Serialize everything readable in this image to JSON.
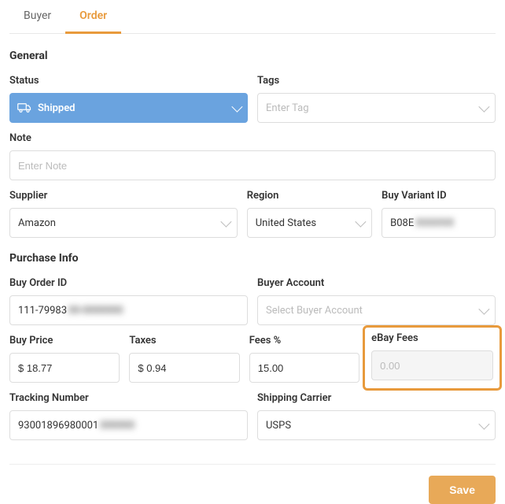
{
  "tabs": {
    "buyer": "Buyer",
    "order": "Order"
  },
  "sections": {
    "general": "General",
    "purchase": "Purchase Info"
  },
  "labels": {
    "status": "Status",
    "tags": "Tags",
    "note": "Note",
    "supplier": "Supplier",
    "region": "Region",
    "buy_variant_id": "Buy Variant ID",
    "buy_order_id": "Buy Order ID",
    "buyer_account": "Buyer Account",
    "buy_price": "Buy Price",
    "taxes": "Taxes",
    "fees_pct": "Fees %",
    "ebay_fees": "eBay Fees",
    "tracking_number": "Tracking Number",
    "shipping_carrier": "Shipping Carrier"
  },
  "values": {
    "status": "Shipped",
    "supplier": "Amazon",
    "region": "United States",
    "buy_variant_id_prefix": "B08E",
    "buy_variant_id_hidden": "XXXXXX",
    "buy_order_id_prefix": "111-79983",
    "buy_order_id_hidden": "00-0000000",
    "buy_price": "$ 18.77",
    "taxes": "$ 0.94",
    "fees_pct": "15.00",
    "tracking_number_prefix": "93001896980001",
    "tracking_number_hidden": "000000",
    "shipping_carrier": "USPS"
  },
  "placeholders": {
    "tags": "Enter Tag",
    "note": "Enter Note",
    "buyer_account": "Select Buyer Account",
    "ebay_fees": "0.00"
  },
  "buttons": {
    "save": "Save"
  }
}
